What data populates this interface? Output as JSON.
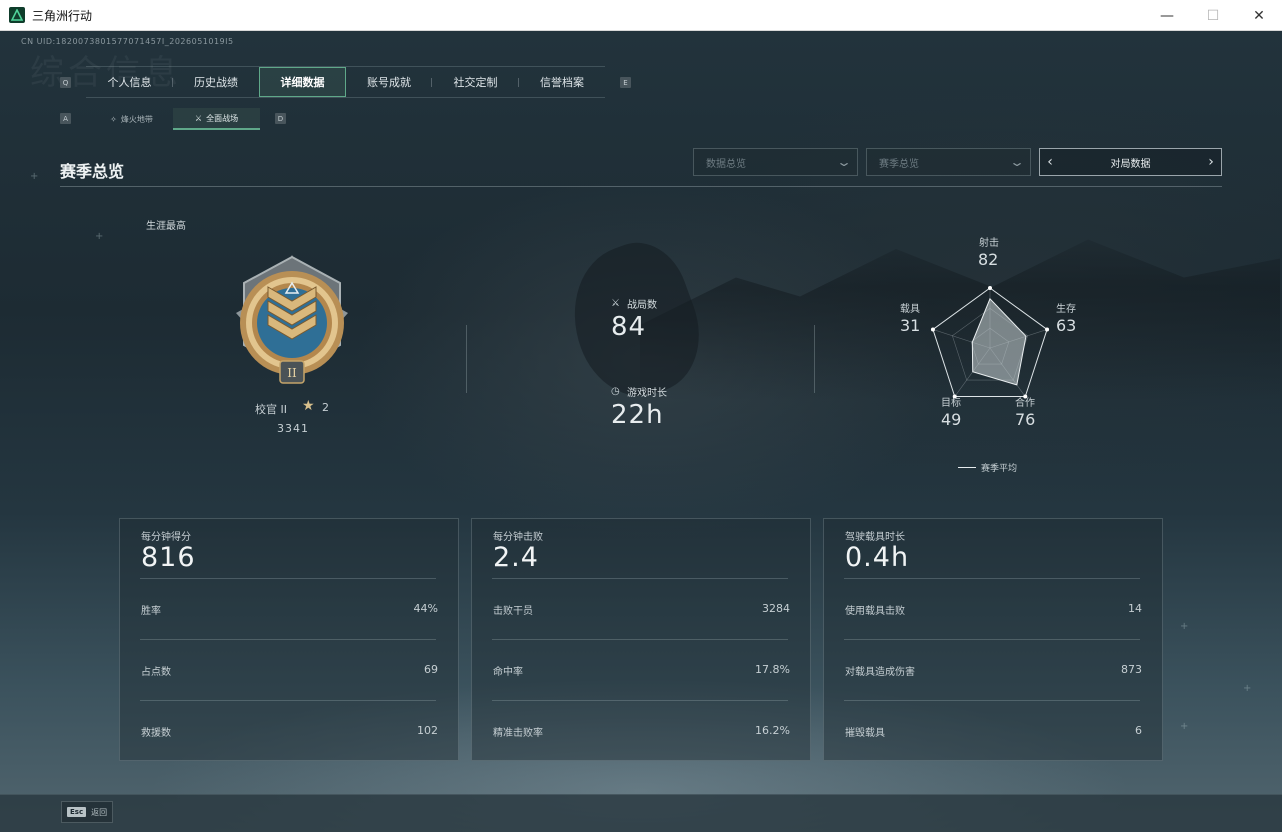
{
  "window": {
    "title": "三角洲行动",
    "minimize": "—",
    "maximize": "☐",
    "close": "✕"
  },
  "header": {
    "uid": "CN UID:1820073801577071457I_2026051019I5",
    "bg_watermark": "综合信息",
    "tab_prev_key": "Q",
    "tab_next_key": "E",
    "tabs": [
      "个人信息",
      "历史战绩",
      "详细数据",
      "账号成就",
      "社交定制",
      "信誉档案"
    ],
    "active_tab": "详细数据",
    "subtab_prev_key": "A",
    "subtab_next_key": "D",
    "subtabs": [
      {
        "label": "烽火地带",
        "icon": "diamond-icon"
      },
      {
        "label": "全面战场",
        "icon": "crossed-swords-icon"
      }
    ],
    "active_subtab": "全面战场"
  },
  "section": {
    "title": "赛季总览",
    "dropdown1": "数据总览",
    "dropdown2": "赛季总览",
    "match_data_button": "对局数据"
  },
  "career": {
    "label": "生涯最高",
    "rank_name": "校官 II",
    "rank_stars": "2",
    "score": "3341"
  },
  "match_stats": {
    "matches_label": "战局数",
    "matches_value": "84",
    "playtime_label": "游戏时长",
    "playtime_value": "22h"
  },
  "radar": {
    "axes": [
      {
        "label": "射击",
        "value": "82"
      },
      {
        "label": "生存",
        "value": "63"
      },
      {
        "label": "合作",
        "value": "76"
      },
      {
        "label": "目标",
        "value": "49"
      },
      {
        "label": "载具",
        "value": "31"
      }
    ],
    "legend": "赛季平均"
  },
  "cards": [
    {
      "title": "每分钟得分",
      "value": "816",
      "rows": [
        {
          "label": "胜率",
          "value": "44%"
        },
        {
          "label": "占点数",
          "value": "69"
        },
        {
          "label": "救援数",
          "value": "102"
        }
      ]
    },
    {
      "title": "每分钟击败",
      "value": "2.4",
      "rows": [
        {
          "label": "击败干员",
          "value": "3284"
        },
        {
          "label": "命中率",
          "value": "17.8%"
        },
        {
          "label": "精准击败率",
          "value": "16.2%"
        }
      ]
    },
    {
      "title": "驾驶载具时长",
      "value": "0.4h",
      "rows": [
        {
          "label": "使用载具击败",
          "value": "14"
        },
        {
          "label": "对载具造成伤害",
          "value": "873"
        },
        {
          "label": "摧毁载具",
          "value": "6"
        }
      ]
    }
  ],
  "footer": {
    "esc_key": "Esc",
    "esc_label": "返回"
  },
  "colors": {
    "accent": "#5fa889",
    "background": "#1d2b33",
    "medal_gold": "#c9a46a",
    "medal_blue": "#2f6f96"
  }
}
